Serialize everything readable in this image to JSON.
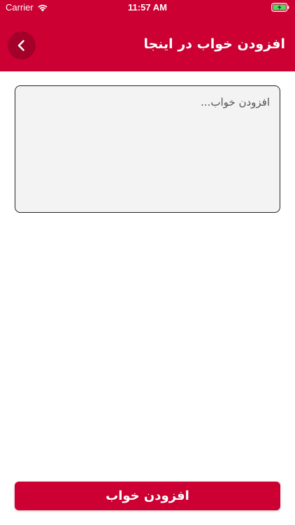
{
  "status_bar": {
    "carrier": "Carrier",
    "time": "11:57 AM",
    "wifi_icon": "wifi-icon",
    "battery_icon": "battery-charging-icon"
  },
  "header": {
    "title": "افزودن خواب در اینجا",
    "back_icon": "chevron-left-icon"
  },
  "form": {
    "dream_input": {
      "placeholder": "افزودن خواب...",
      "value": ""
    },
    "submit_label": "افزودن خواب"
  },
  "colors": {
    "primary": "#cc0033",
    "back_button": "#a3002a",
    "textarea_bg": "#f3f3f3"
  }
}
